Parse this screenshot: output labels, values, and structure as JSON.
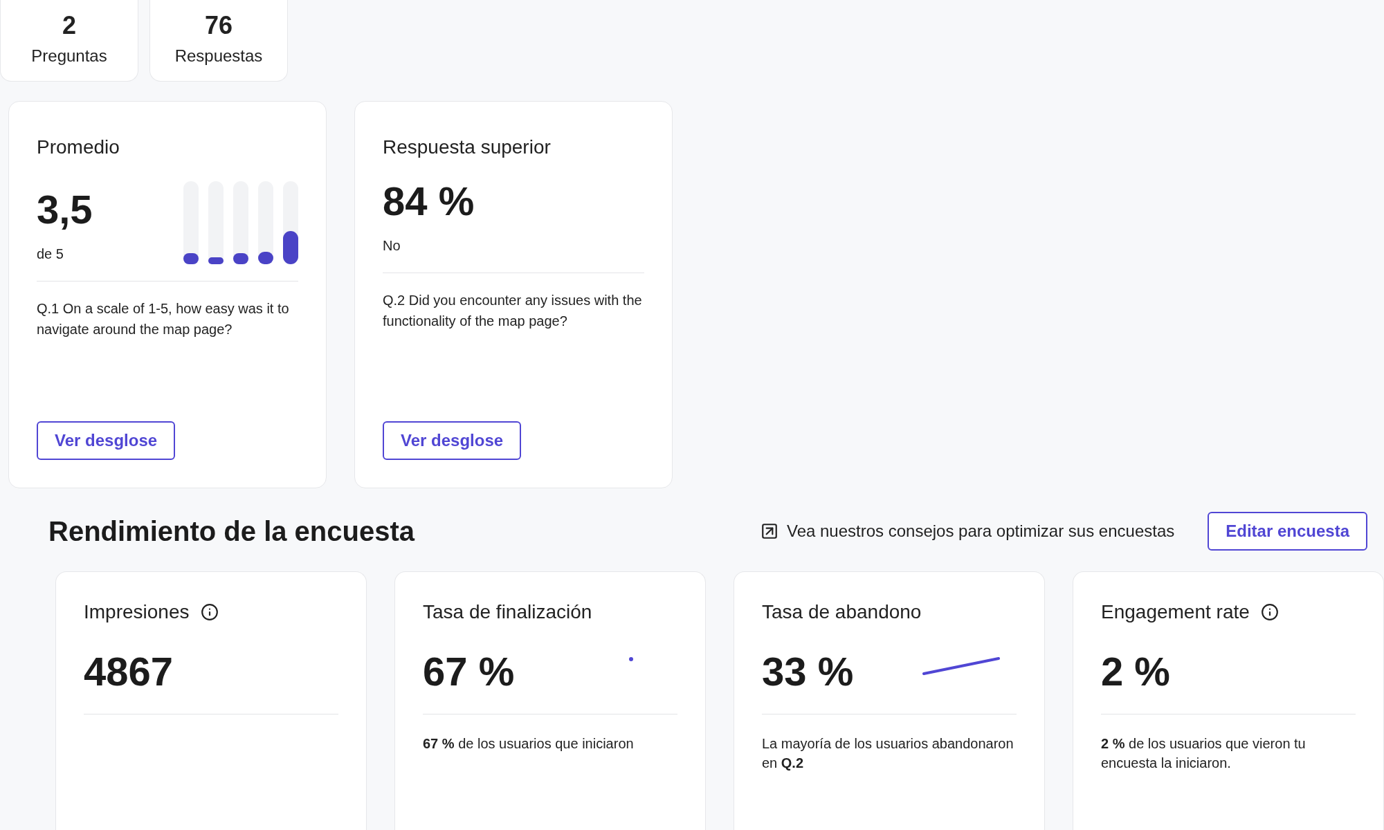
{
  "stats": [
    {
      "value": "2",
      "label": "Preguntas"
    },
    {
      "value": "76",
      "label": "Respuestas"
    }
  ],
  "question_cards": [
    {
      "kind": "average",
      "title": "Promedio",
      "value": "3,5",
      "caption": "de 5",
      "distribution": [
        {
          "level": 0.13
        },
        {
          "level": 0.07
        },
        {
          "level": 0.13
        },
        {
          "level": 0.15
        },
        {
          "level": 0.4
        }
      ],
      "question": "Q.1 On a scale of 1-5, how easy was it to navigate around the map page?",
      "button": "Ver desglose"
    },
    {
      "kind": "top_answer",
      "title": "Respuesta superior",
      "value": "84 %",
      "caption": "No",
      "question": "Q.2 Did you encounter any issues with the functionality of the map page?",
      "button": "Ver desglose"
    }
  ],
  "performance": {
    "tips_link": "Vea nuestros consejos para optimizar sus encuestas",
    "edit_button": "Editar encuesta",
    "title": "Rendimiento de la encuesta",
    "metrics": [
      {
        "kind": "info",
        "title": "Impresiones",
        "value": "4867"
      },
      {
        "kind": "dot_trend",
        "title": "Tasa de finalización",
        "value": "67 %",
        "description": "**67 %** de los usuarios que iniciaron"
      },
      {
        "kind": "line_trend",
        "title": "Tasa de abandono",
        "value": "33 %",
        "description": "La mayoría de los usuarios abandonaron en **Q.2**"
      },
      {
        "kind": "info",
        "title": "Engagement rate",
        "value": "2 %",
        "description": "**2 %** de los usuarios que vieron tu encuesta la iniciaron."
      }
    ]
  }
}
